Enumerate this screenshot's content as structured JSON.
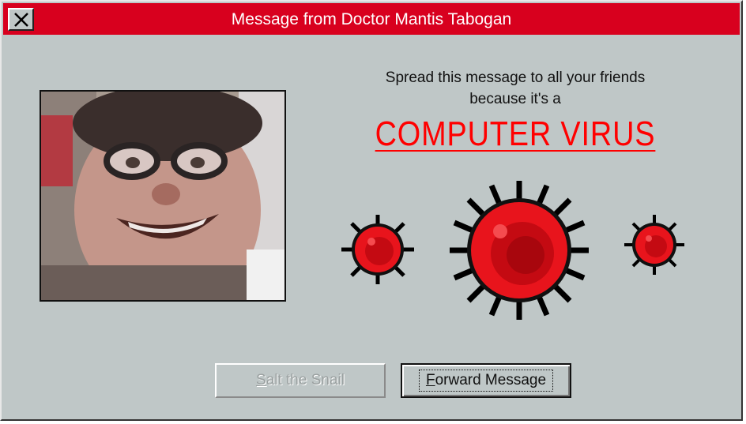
{
  "window": {
    "title": "Message from Doctor Mantis Tabogan",
    "close_icon": "close-x-icon",
    "colors": {
      "titlebar": "#d8001e",
      "face": "#bfc7c7",
      "virus_red": "#ff0000"
    }
  },
  "message": {
    "line1": "Spread this message to all your friends",
    "line2": "because it's a",
    "headline": "COMPUTER VIRUS"
  },
  "images": {
    "photo": "pixelated-face-photo",
    "virus_icons": [
      "virus-icon",
      "virus-icon",
      "virus-icon"
    ]
  },
  "buttons": {
    "salt": {
      "first_letter": "S",
      "rest": "alt the Snail",
      "disabled": true
    },
    "forward": {
      "first_letter": "F",
      "rest": "orward Message",
      "default": true
    }
  }
}
